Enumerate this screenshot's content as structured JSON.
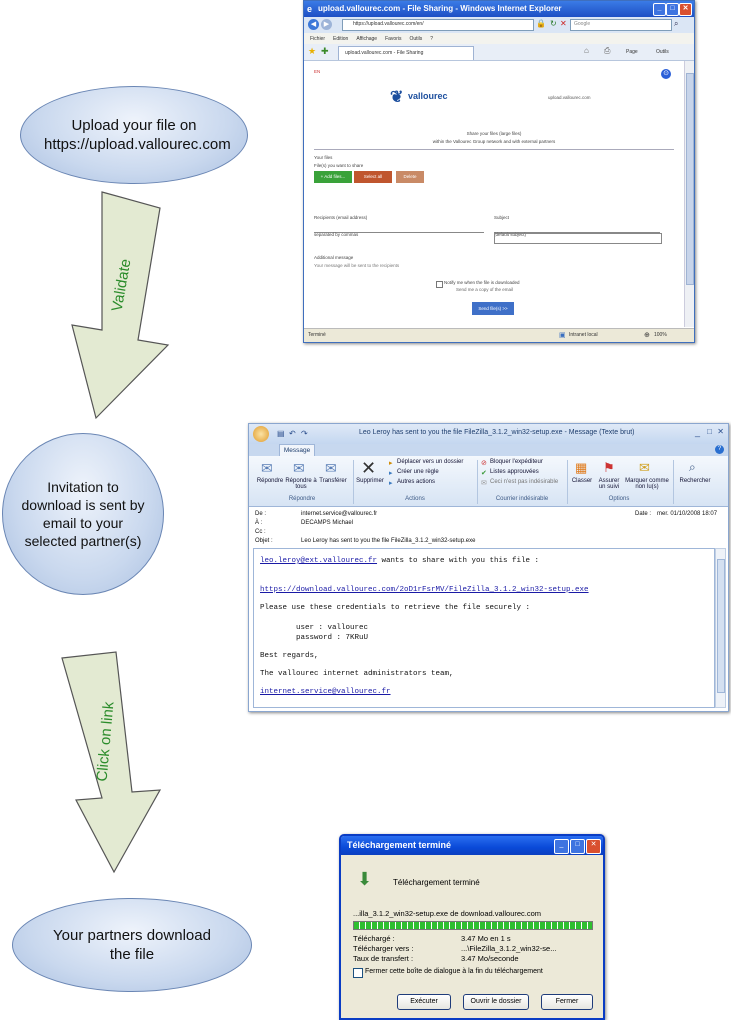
{
  "flow": {
    "step1": "Upload your file on https://upload.vallourec.com",
    "step2": "Invitation to download is sent by email to your selected partner(s)",
    "step3": "Your partners download the file",
    "arrow1_label": "Validate",
    "arrow2_label": "Click on link"
  },
  "ie_window": {
    "title": "upload.vallourec.com - File Sharing - Windows Internet Explorer",
    "address": "https://upload.vallourec.com/en/",
    "search_placeholder": "Google",
    "menu": [
      "Fichier",
      "Edition",
      "Affichage",
      "Favoris",
      "Outils",
      "?"
    ],
    "tab_label": "upload.vallourec.com - File Sharing",
    "toolbar_page": "Page",
    "toolbar_tools": "Outils",
    "flag_label": "EN",
    "brand": "vallourec",
    "brand_url": "upload.vallourec.com",
    "intro_line1": "Share your files (large files)",
    "intro_line2": "within the Vallourec Group network and with external partners",
    "files_label": "Your files",
    "files_hint": "File(s) you want to share",
    "btn_add": "+ Add files...",
    "btn_select": "Select all",
    "btn_delete": "Delete",
    "recipients_label": "Recipients (email address)",
    "recipients_value": "separated by commas",
    "subject_label": "Subject",
    "subject_value": "(default subject)",
    "message_label": "Additional message",
    "message_value": "Your message will be sent to the recipients",
    "notify_label": "Notify me when the file is downloaded",
    "notify_sub": "Send me a copy of the email",
    "send_button": "Send file(s) >>",
    "status_left": "Terminé",
    "status_zone": "Intranet local",
    "status_zoom": "100%"
  },
  "mail_window": {
    "title": "Leo Leroy has sent to you the file FileZilla_3.1.2_win32-setup.exe - Message (Texte brut)",
    "tab": "Message",
    "group_respond": "Répondre",
    "btn_reply": "Répondre",
    "btn_reply_all": "Répondre à tous",
    "btn_forward": "Transférer",
    "group_actions": "Actions",
    "btn_delete": "Supprimer",
    "act_move": "Déplacer vers un dossier",
    "act_rule": "Créer une règle",
    "act_other": "Autres actions",
    "group_junk": "Courrier indésirable",
    "junk_block": "Bloquer l'expéditeur",
    "junk_lists": "Listes approuvées",
    "junk_not": "Ceci n'est pas indésirable",
    "group_options": "Options",
    "btn_categorize": "Classer",
    "btn_follow": "Assurer un suivi",
    "btn_mark": "Marquer comme non lu(s)",
    "btn_find": "Rechercher",
    "from_label": "De :",
    "from_value": "internet.service@vallourec.fr",
    "to_label": "À :",
    "to_value": "DECAMPS Michael",
    "cc_label": "Cc :",
    "subject_label": "Objet :",
    "subject_value": "Leo Leroy has sent to you the file FileZilla_3.1.2_win32-setup.exe",
    "date_label": "Date :",
    "date_value": "mer. 01/10/2008 18:07",
    "body_sender": "leo.leroy@ext.vallourec.fr",
    "body_line1_rest": " wants to share with you this file :",
    "body_link": "https://download.vallourec.com/2oD1rFsrMV/FileZilla_3.1.2_win32-setup.exe",
    "body_line3": "Please use these credentials to retrieve the file securely :",
    "body_user": "user : vallourec",
    "body_password": "password : 7KRuU",
    "body_regards": "Best regards,",
    "body_team": "The vallourec internet administrators team,",
    "body_sig_link": "internet.service@vallourec.fr"
  },
  "download_window": {
    "title": "Téléchargement terminé",
    "heading": "Téléchargement terminé",
    "file_line": "...illa_3.1.2_win32-setup.exe de download.vallourec.com",
    "progress_fraction": 1.0,
    "downloaded_label": "Téléchargé :",
    "downloaded_value": "3.47 Mo en 1 s",
    "dest_label": "Télécharger vers :",
    "dest_value": "...\\FileZilla_3.1.2_win32-se...",
    "rate_label": "Taux de transfert :",
    "rate_value": "3.47 Mo/seconde",
    "close_checkbox": "Fermer cette boîte de dialogue à la fin du téléchargement",
    "btn_run": "Exécuter",
    "btn_open_folder": "Ouvrir le dossier",
    "btn_close": "Fermer"
  },
  "colors": {
    "ellipse_fill": "#c9d8ee",
    "arrow_fill": "#e3ead2",
    "arrow_text": "#2b8c2b",
    "xp_blue": "#2a5fd8",
    "vallourec_blue": "#1d4f9e"
  }
}
